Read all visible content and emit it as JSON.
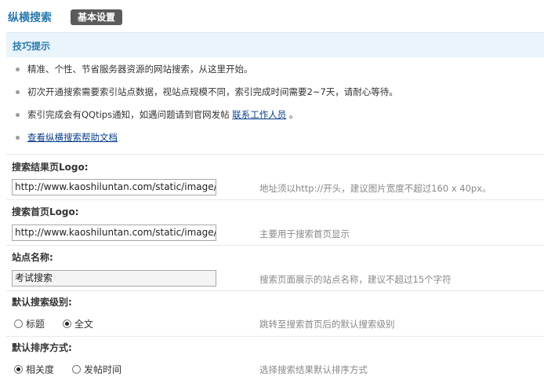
{
  "header": {
    "title": "纵横搜索",
    "tab_label": "基本设置"
  },
  "tips": {
    "heading": "技巧提示",
    "items": [
      "精准、个性、节省服务器资源的网站搜索，从这里开始。",
      "初次开通搜索需要索引站点数据，视站点规模不同，索引完成时间需要2~7天，请耐心等待。",
      "索引完成会有QQtips通知，如遇问题请到官网发帖"
    ],
    "contact_link": "联系工作人员",
    "contact_suffix": "。",
    "help_link": "查看纵横搜索帮助文档"
  },
  "form": {
    "result_logo": {
      "label": "搜索结果页Logo:",
      "value": "http://www.kaoshiluntan.com/static/image/common/logo.png",
      "hint": "地址须以http://开头，建议图片宽度不超过160 x 40px。"
    },
    "home_logo": {
      "label": "搜索首页Logo:",
      "value": "http://www.kaoshiluntan.com/static/image/common/logo.png",
      "hint": "主要用于搜索首页显示"
    },
    "site_name": {
      "label": "站点名称:",
      "value": "考试搜索",
      "hint": "搜索页面展示的站点名称，建议不超过15个字符"
    },
    "search_level": {
      "label": "默认搜索级别:",
      "options": [
        "标题",
        "全文"
      ],
      "selected": "全文",
      "hint": "跳转至搜索首页后的默认搜索级别"
    },
    "sort_order": {
      "label": "默认排序方式:",
      "options": [
        "相关度",
        "发帖时间"
      ],
      "selected": "相关度",
      "hint": "选择搜索结果默认排序方式"
    }
  }
}
